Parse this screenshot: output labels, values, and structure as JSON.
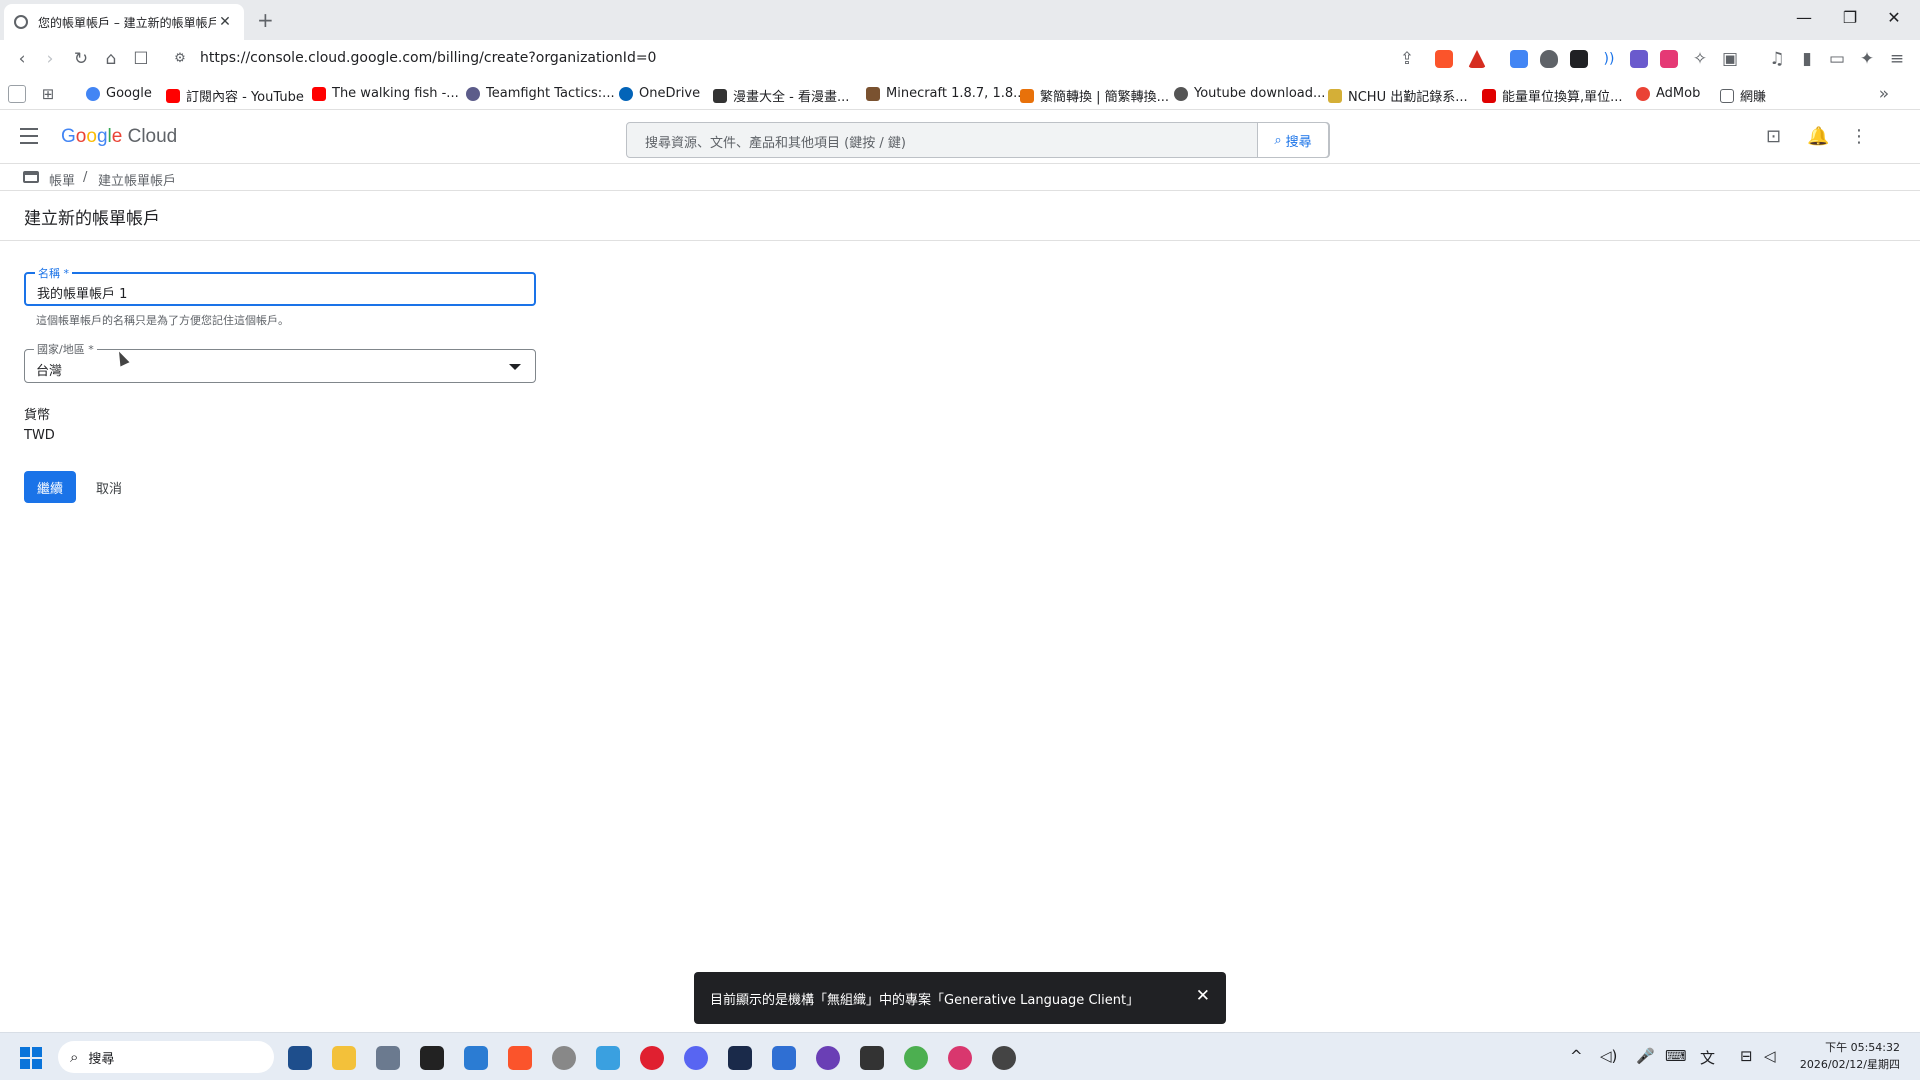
{
  "browser": {
    "tab_title": "您的帳單帳戶 – 建立新的帳單帳戶",
    "url": "https://console.cloud.google.com/billing/create?organizationId=0",
    "bookmarks": [
      {
        "label": "Google",
        "color": "#4285f4"
      },
      {
        "label": "訂閱內容 - YouTube",
        "color": "#ff0000"
      },
      {
        "label": "The walking fish -...",
        "color": "#ff0000"
      },
      {
        "label": "Teamfight Tactics:...",
        "color": "#5c5c8a"
      },
      {
        "label": "OneDrive",
        "color": "#0364b8"
      },
      {
        "label": "漫畫大全 - 看漫畫...",
        "color": "#333333"
      },
      {
        "label": "Minecraft 1.8.7, 1.8....",
        "color": "#7a5230"
      },
      {
        "label": "繁簡轉換 | 簡繁轉換...",
        "color": "#e8710a"
      },
      {
        "label": "Youtube download...",
        "color": "#555555"
      },
      {
        "label": "NCHU 出勤記錄系...",
        "color": "#d4af37"
      },
      {
        "label": "能量單位換算,單位...",
        "color": "#e00000"
      },
      {
        "label": "AdMob",
        "color": "#ea4335"
      },
      {
        "label": "網賺",
        "color": "#5f6368"
      }
    ]
  },
  "header": {
    "logo_google": [
      "G",
      "o",
      "o",
      "g",
      "l",
      "e"
    ],
    "logo_cloud": "Cloud",
    "search_placeholder": "搜尋資源、文件、產品和其他項目 (鍵按 / 鍵)",
    "search_button": "搜尋"
  },
  "breadcrumb": {
    "items": [
      "帳單",
      "建立帳單帳戶"
    ],
    "separator": "/"
  },
  "page": {
    "title": "建立新的帳單帳戶"
  },
  "form": {
    "name_label": "名稱 *",
    "name_value": "我的帳單帳戶 1",
    "name_hint": "這個帳單帳戶的名稱只是為了方便您記住這個帳戶。",
    "country_label": "國家/地區 *",
    "country_value": "台灣",
    "currency_label": "貨幣",
    "currency_value": "TWD",
    "continue_button": "繼續",
    "cancel_button": "取消"
  },
  "snackbar": {
    "message": "目前顯示的是機構「無組織」中的專案「Generative Language Client」"
  },
  "taskbar": {
    "search_label": "搜尋",
    "time": "下午 05:54:32",
    "date": "2026/02/12/星期四"
  },
  "colors": {
    "accent": "#1a73e8",
    "snackbar_bg": "#202124"
  }
}
